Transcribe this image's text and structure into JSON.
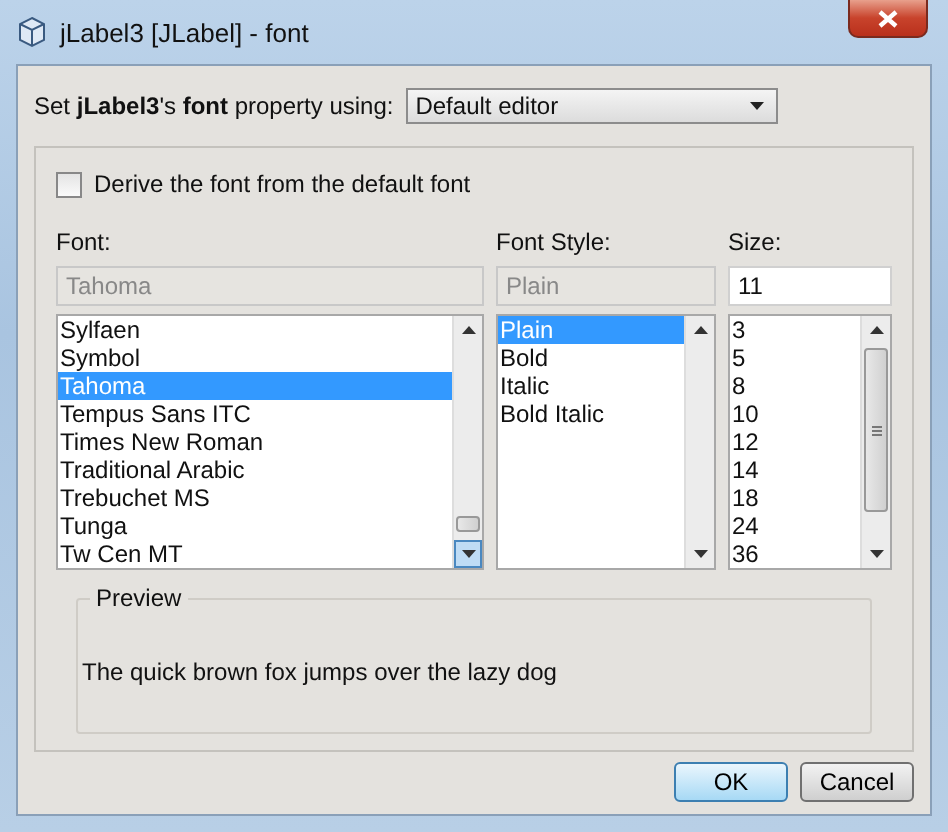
{
  "window": {
    "title": "jLabel3 [JLabel] - font"
  },
  "editor_row": {
    "label": "Set **jLabel3**'s **font** property using:",
    "combo": "Default editor"
  },
  "derive": {
    "label": "Derive the font from the default font",
    "checked": false
  },
  "font": {
    "label": "Font:",
    "value": "Tahoma",
    "disabled": true,
    "items": [
      {
        "text": "Sylfaen",
        "selected": false
      },
      {
        "text": "Symbol",
        "selected": false
      },
      {
        "text": "Tahoma",
        "selected": true
      },
      {
        "text": "Tempus Sans ITC",
        "selected": false
      },
      {
        "text": "Times New Roman",
        "selected": false
      },
      {
        "text": "Traditional Arabic",
        "selected": false
      },
      {
        "text": "Trebuchet MS",
        "selected": false
      },
      {
        "text": "Tunga",
        "selected": false
      },
      {
        "text": "Tw Cen MT",
        "selected": false
      }
    ]
  },
  "style": {
    "label": "Font Style:",
    "value": "Plain",
    "disabled": true,
    "items": [
      {
        "text": "Plain",
        "selected": true
      },
      {
        "text": "Bold",
        "selected": false
      },
      {
        "text": "Italic",
        "selected": false
      },
      {
        "text": "Bold Italic",
        "selected": false
      }
    ]
  },
  "size": {
    "label": "Size:",
    "value": "11",
    "disabled": false,
    "items": [
      {
        "text": "3",
        "selected": false
      },
      {
        "text": "5",
        "selected": false
      },
      {
        "text": "8",
        "selected": false
      },
      {
        "text": "10",
        "selected": false
      },
      {
        "text": "12",
        "selected": false
      },
      {
        "text": "14",
        "selected": false
      },
      {
        "text": "18",
        "selected": false
      },
      {
        "text": "24",
        "selected": false
      },
      {
        "text": "36",
        "selected": false
      }
    ]
  },
  "preview": {
    "title": "Preview",
    "text": "The quick brown fox jumps over the lazy dog"
  },
  "buttons": [
    {
      "label": "OK",
      "kind": "default"
    },
    {
      "label": "Cancel",
      "kind": "normal"
    }
  ]
}
